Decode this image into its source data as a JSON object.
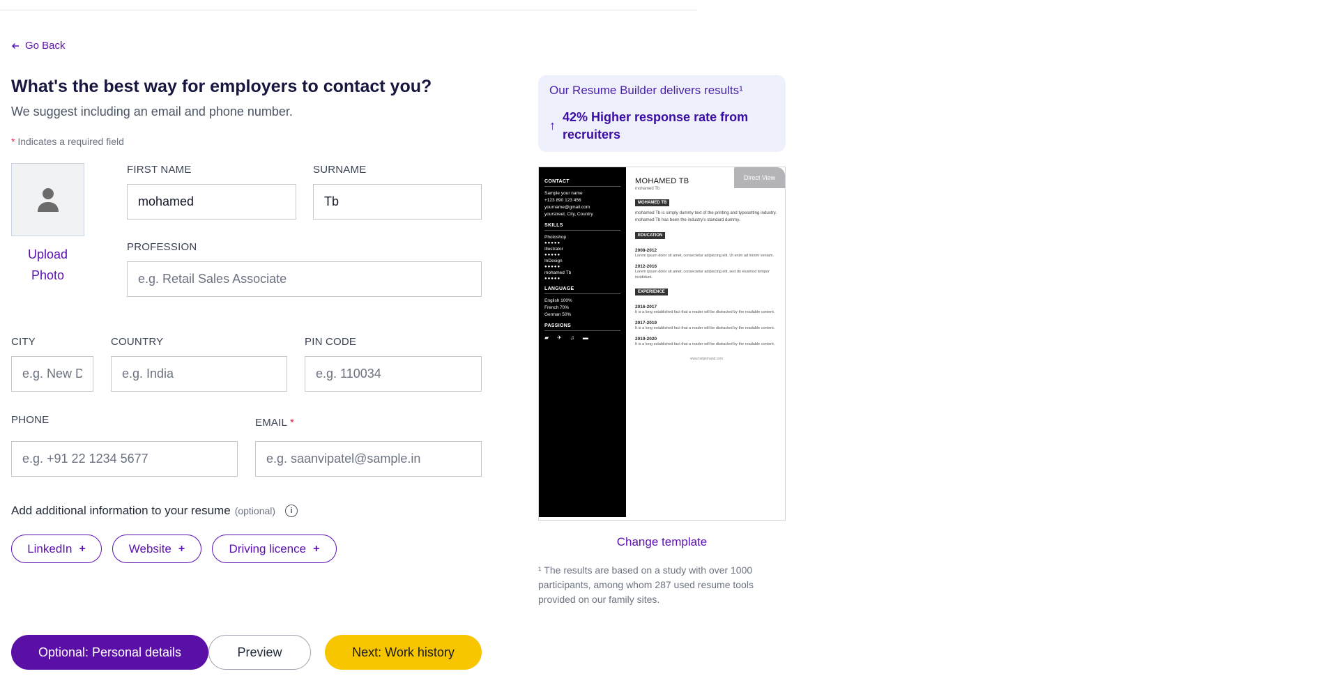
{
  "nav": {
    "go_back": "Go Back"
  },
  "header": {
    "title": "What's the best way for employers to contact you?",
    "subtitle": "We suggest including an email and phone number.",
    "required_star": "*",
    "required_note": "Indicates a required field"
  },
  "photo": {
    "upload_line1": "Upload",
    "upload_line2": "Photo"
  },
  "form": {
    "first_name": {
      "label": "FIRST NAME",
      "value": "mohamed"
    },
    "surname": {
      "label": "SURNAME",
      "value": "Tb"
    },
    "profession": {
      "label": "PROFESSION",
      "placeholder": "e.g. Retail Sales Associate"
    },
    "city": {
      "label": "CITY",
      "placeholder": "e.g. New Delhi"
    },
    "country": {
      "label": "COUNTRY",
      "placeholder": "e.g. India"
    },
    "pin_code": {
      "label": "PIN CODE",
      "placeholder": "e.g. 110034"
    },
    "phone": {
      "label": "PHONE",
      "placeholder": "e.g. +91 22 1234 5677"
    },
    "email": {
      "label": "EMAIL",
      "required_star": "*",
      "placeholder": "e.g. saanvipatel@sample.in"
    }
  },
  "additional": {
    "text": "Add additional information to your resume",
    "optional": "(optional)",
    "info_glyph": "i",
    "chips": [
      {
        "label": "LinkedIn",
        "plus": "+"
      },
      {
        "label": "Website",
        "plus": "+"
      },
      {
        "label": "Driving licence",
        "plus": "+"
      }
    ]
  },
  "buttons": {
    "personal": "Optional: Personal details",
    "preview": "Preview",
    "next": "Next: Work history"
  },
  "results": {
    "title": "Our Resume Builder delivers results¹",
    "arrow": "↑",
    "stat": "42% Higher response rate from recruiters"
  },
  "resume_preview": {
    "direct_view": "Direct View",
    "contact_heading": "CONTACT",
    "contact_lines": [
      "Sample your name",
      "+123 890 123 456",
      "yourname@gmail.com",
      "yourstreet, City, Country"
    ],
    "skills_heading": "SKILLS",
    "skills": [
      {
        "name": "Photoshop",
        "dots": "●●●●●"
      },
      {
        "name": "Illustrator",
        "dots": "●●●●●"
      },
      {
        "name": "InDesign",
        "dots": "●●●●●"
      },
      {
        "name": "mohamed Tb",
        "dots": "●●●●●"
      }
    ],
    "language_heading": "LANGUAGE",
    "languages": [
      "English  100%",
      "French  70%",
      "German  50%"
    ],
    "passions_heading": "PASSIONS",
    "passion_icons": [
      "▰",
      "✈",
      "♫",
      "▬"
    ],
    "name": "MOHAMED TB",
    "subname": "mohamed Tb",
    "profile_tag": "MOHAMED TB",
    "profile_text": "mohamed Tb is simply dummy text of the printing and typesetting industry. mohamed Tb has been the industry's standard dummy.",
    "education_tag": "EDUCATION",
    "education": [
      {
        "years": "2008-2012",
        "text": "Lorem ipsum dolor sit amet, consectetur adipiscing elit. Ut enim ad minim veniam."
      },
      {
        "years": "2012-2016",
        "text": "Lorem ipsum dolor sit amet, consectetur adipiscing elit, sed do eiusmod tempor incididunt."
      }
    ],
    "experience_tag": "EXPERIENCE",
    "experience": [
      {
        "years": "2016-2017",
        "text": "It is a long established fact that a reader will be distracted by the readable content."
      },
      {
        "years": "2017-2019",
        "text": "It is a long established fact that a reader will be distracted by the readable content."
      },
      {
        "years": "2019-2020",
        "text": "It is a long established fact that a reader will be distracted by the readable content."
      }
    ],
    "footer_url": "www.helpinhand.com"
  },
  "change_template": "Change template",
  "footnote": "¹ The results are based on a study with over 1000 participants, among whom 287 used resume tools provided on our family sites."
}
